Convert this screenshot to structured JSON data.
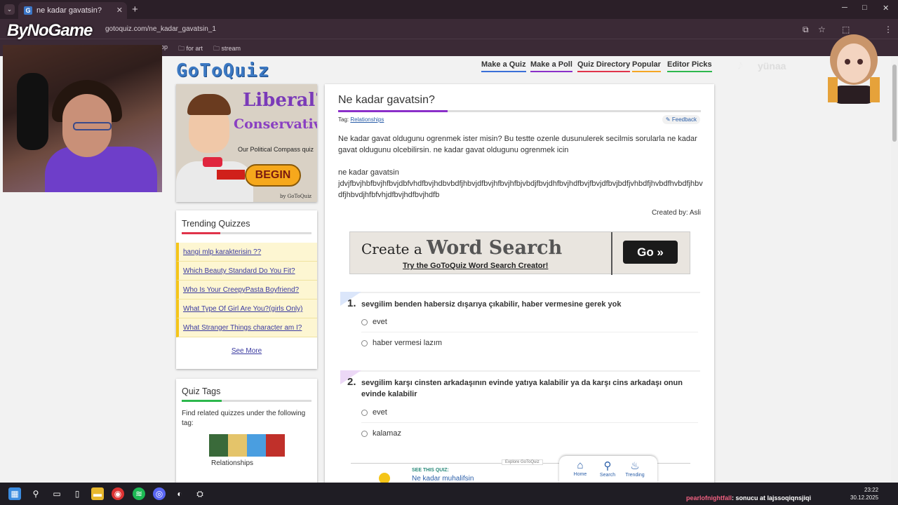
{
  "browser": {
    "tab_title": "ne kadar gavatsin?",
    "tab_icon": "G",
    "url": "gotoquiz.com/ne_kadar_gavatsin_1",
    "bookmarks": [
      "op",
      "for art",
      "stream"
    ],
    "win_controls": [
      "─",
      "□",
      "✕"
    ]
  },
  "overlay": {
    "brand": "ByNoGame",
    "tiktok_handle": "yünaa"
  },
  "site": {
    "logo": "GoToQuiz",
    "nav": [
      {
        "label": "Make a Quiz",
        "color": "#3a6fd8"
      },
      {
        "label": "Make a Poll",
        "color": "#8a2fc9"
      },
      {
        "label": "Quiz Directory",
        "color": "#e0334a"
      },
      {
        "label": "Popular",
        "color": "#f5a623"
      },
      {
        "label": "Editor Picks",
        "color": "#2db84d"
      }
    ]
  },
  "promo": {
    "line1": "Liberal?",
    "line2": "Conservative?",
    "line3": "Our Political Compass quiz",
    "button": "BEGIN",
    "credit": "by GoToQuiz"
  },
  "trending": {
    "title": "Trending Quizzes",
    "items": [
      "hangi mlp karakterisin ??",
      "Which Beauty Standard Do You Fit?",
      "Who Is Your CreepyPasta Boyfriend?",
      "What Type Of Girl Are You?(girls Only)",
      "What Stranger Things character am I?"
    ],
    "see_more": "See More"
  },
  "tags": {
    "title": "Quiz Tags",
    "desc": "Find related quizzes under the following tag:",
    "tag": "Relationships"
  },
  "quiz": {
    "title": "Ne kadar gavatsin?",
    "tag_label": "Tag:",
    "tag": "Relationships",
    "feedback": "Feedback",
    "description": "Ne kadar gavat oldugunu ogrenmek ister misin? Bu testte ozenle dusunulerek secilmis sorularla ne kadar gavat oldugunu olcebilirsin. ne kadar gavat oldugunu ogrenmek icin",
    "description2_title": "ne kadar gavatsin",
    "description2_body": "jdvjfbvjhbfbvjhfbvjdbfvhdfbvjhdbvbdfjhbvjdfbvjhfbvjhfbjvbdjfbvjdhfbvjhdfbvjfbvjdfbvjbdfjvhbdfjhvbdfhvbdfjhbvdfjhbvdjhfbfvhjdfbvjhdfbvjhdfb",
    "created_by": "Created by: Asli",
    "ad_line1": "Create a",
    "ad_line1b": "Word Search",
    "ad_line2": "Try the GoToQuiz Word Search Creator!",
    "ad_go": "Go »",
    "questions": [
      {
        "num": "1.",
        "text": "sevgilim benden habersiz dışarıya çıkabilir, haber vermesine gerek yok",
        "options": [
          "evet",
          "haber vermesi lazım"
        ],
        "accent": "#4a7dd6"
      },
      {
        "num": "2.",
        "text": "sevgilim karşı cinsten arkadaşının evinde yatıya kalabilir ya da karşı cins arkadaşı onun evinde kalabilir",
        "options": [
          "evet",
          "kalamaz"
        ],
        "accent": "#a24ad6"
      }
    ],
    "explore_label": "Explore GoToQuiz",
    "see_this": "SEE THIS QUIZ:",
    "see_this_name": "Ne kadar muhalifsin"
  },
  "bottom_nav": [
    "Home",
    "Search",
    "Trending"
  ],
  "taskbar": {
    "chat_user": "pearlofnightfall",
    "chat_msg": ": sonucu at lajssoqiqnsjiqi",
    "time": "23:22",
    "date": "30.12.2025"
  }
}
